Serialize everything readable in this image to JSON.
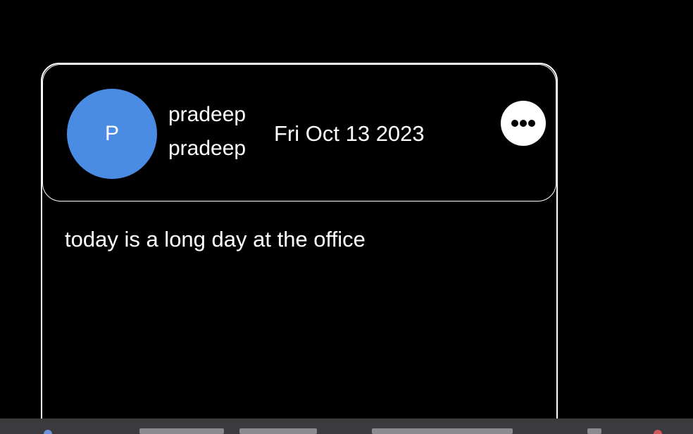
{
  "post": {
    "avatar_initial": "P",
    "name_line1": "pradeep",
    "name_line2": "pradeep",
    "date": "Fri Oct 13 2023",
    "content": "today is a long day at the office",
    "more_icon": "ellipsis-horizontal-icon"
  },
  "colors": {
    "background": "#000000",
    "avatar": "#4a8be4",
    "text": "#ffffff",
    "taskbar": "#3b3b3d"
  }
}
